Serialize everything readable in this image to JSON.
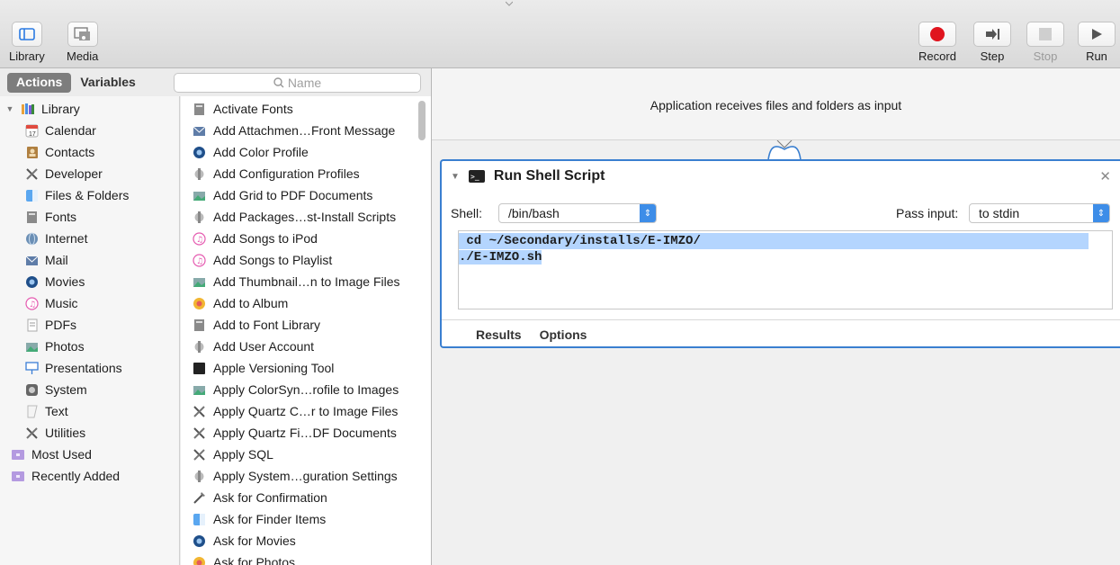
{
  "toolbar": {
    "library_label": "Library",
    "media_label": "Media",
    "record_label": "Record",
    "step_label": "Step",
    "stop_label": "Stop",
    "run_label": "Run"
  },
  "sidebar": {
    "tab_actions": "Actions",
    "tab_variables": "Variables",
    "search_placeholder": "Name",
    "library": [
      {
        "label": "Library",
        "icon": "library-icon"
      },
      {
        "label": "Calendar",
        "icon": "calendar-icon"
      },
      {
        "label": "Contacts",
        "icon": "contacts-icon"
      },
      {
        "label": "Developer",
        "icon": "developer-tools-icon"
      },
      {
        "label": "Files & Folders",
        "icon": "finder-icon"
      },
      {
        "label": "Fonts",
        "icon": "fonts-icon"
      },
      {
        "label": "Internet",
        "icon": "internet-icon"
      },
      {
        "label": "Mail",
        "icon": "mail-icon"
      },
      {
        "label": "Movies",
        "icon": "movies-icon"
      },
      {
        "label": "Music",
        "icon": "music-icon"
      },
      {
        "label": "PDFs",
        "icon": "pdf-icon"
      },
      {
        "label": "Photos",
        "icon": "photos-icon"
      },
      {
        "label": "Presentations",
        "icon": "presentation-icon"
      },
      {
        "label": "System",
        "icon": "system-icon"
      },
      {
        "label": "Text",
        "icon": "text-icon"
      },
      {
        "label": "Utilities",
        "icon": "utilities-icon"
      },
      {
        "label": "Most Used",
        "icon": "folder-icon"
      },
      {
        "label": "Recently Added",
        "icon": "folder-icon"
      }
    ],
    "actions": [
      "Activate Fonts",
      "Add Attachmen…Front Message",
      "Add Color Profile",
      "Add Configuration Profiles",
      "Add Grid to PDF Documents",
      "Add Packages…st-Install Scripts",
      "Add Songs to iPod",
      "Add Songs to Playlist",
      "Add Thumbnail…n to Image Files",
      "Add to Album",
      "Add to Font Library",
      "Add User Account",
      "Apple Versioning Tool",
      "Apply ColorSyn…rofile to Images",
      "Apply Quartz C…r to Image Files",
      "Apply Quartz Fi…DF Documents",
      "Apply SQL",
      "Apply System…guration Settings",
      "Ask for Confirmation",
      "Ask for Finder Items",
      "Ask for Movies",
      "Ask for Photos"
    ]
  },
  "workflow": {
    "input_text": "Application receives files and folders as input",
    "action": {
      "title": "Run Shell Script",
      "shell_label": "Shell:",
      "shell_value": "/bin/bash",
      "pass_input_label": "Pass input:",
      "pass_input_value": "to stdin",
      "script_line1": " cd ~/Secondary/installs/E-IMZO/",
      "script_line2": "./E-IMZO.sh",
      "results_label": "Results",
      "options_label": "Options"
    }
  },
  "colors": {
    "accent": "#3d8de8",
    "record": "#e0141e",
    "selection": "#b4d5fe"
  }
}
